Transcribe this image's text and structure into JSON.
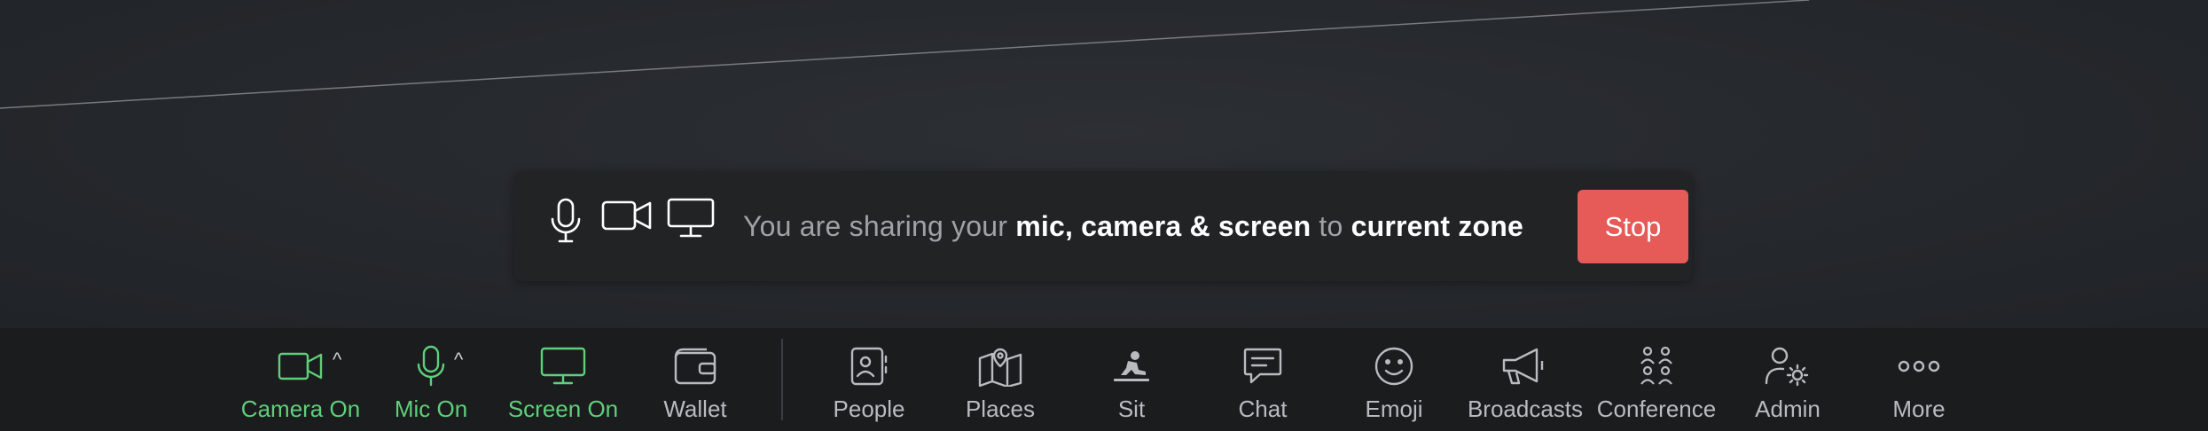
{
  "banner": {
    "prefix": "You are sharing your ",
    "items": "mic, camera & screen",
    "middle": " to ",
    "target": "current zone",
    "stop_label": "Stop",
    "icons": [
      "mic-icon",
      "camera-icon",
      "screen-icon"
    ]
  },
  "toolbar": {
    "camera": {
      "label": "Camera On",
      "icon": "camera-icon",
      "state": "on"
    },
    "mic": {
      "label": "Mic On",
      "icon": "mic-icon",
      "state": "on"
    },
    "screen": {
      "label": "Screen On",
      "icon": "screen-icon",
      "state": "on"
    },
    "wallet": {
      "label": "Wallet",
      "icon": "wallet-icon"
    },
    "people": {
      "label": "People",
      "icon": "people-icon"
    },
    "places": {
      "label": "Places",
      "icon": "map-icon"
    },
    "sit": {
      "label": "Sit",
      "icon": "sit-icon"
    },
    "chat": {
      "label": "Chat",
      "icon": "chat-icon"
    },
    "emoji": {
      "label": "Emoji",
      "icon": "emoji-icon"
    },
    "broadcasts": {
      "label": "Broadcasts",
      "icon": "megaphone-icon"
    },
    "conference": {
      "label": "Conference",
      "icon": "conference-icon"
    },
    "admin": {
      "label": "Admin",
      "icon": "admin-icon"
    },
    "more": {
      "label": "More",
      "icon": "more-icon"
    }
  },
  "colors": {
    "active_green": "#5fcf7a",
    "stop_red": "#e65a58",
    "toolbar_bg": "#1b1c1e",
    "banner_bg": "#222325",
    "icon_grey": "#b9bbbe"
  }
}
